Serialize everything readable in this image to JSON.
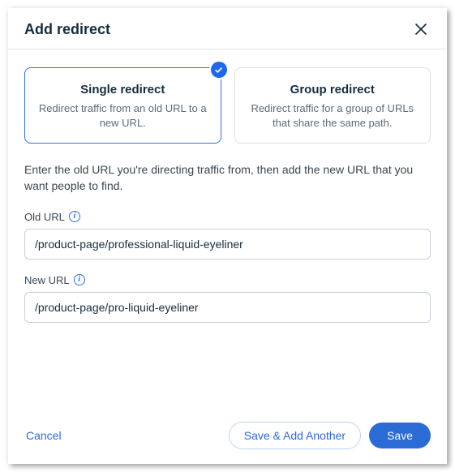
{
  "header": {
    "title": "Add redirect"
  },
  "options": {
    "single": {
      "title": "Single redirect",
      "desc": "Redirect traffic from an old URL to a new URL."
    },
    "group": {
      "title": "Group redirect",
      "desc": "Redirect traffic for a group of URLs that share the same path."
    }
  },
  "instructions": "Enter the old URL you're directing traffic from, then add the new URL that you want people to find.",
  "fields": {
    "old": {
      "label": "Old URL",
      "value": "/product-page/professional-liquid-eyeliner"
    },
    "new": {
      "label": "New URL",
      "value": "/product-page/pro-liquid-eyeliner"
    },
    "info": "i"
  },
  "footer": {
    "cancel": "Cancel",
    "saveAnother": "Save & Add Another",
    "save": "Save"
  }
}
